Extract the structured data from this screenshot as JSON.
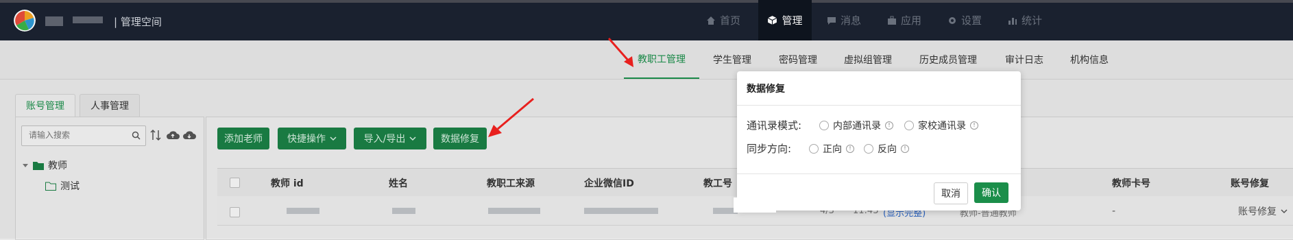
{
  "header": {
    "space_label": "| 管理空间",
    "nav": [
      {
        "label": "首页",
        "icon": "home-icon"
      },
      {
        "label": "管理",
        "icon": "cube-icon"
      },
      {
        "label": "消息",
        "icon": "message-icon"
      },
      {
        "label": "应用",
        "icon": "briefcase-icon"
      },
      {
        "label": "设置",
        "icon": "gear-icon"
      },
      {
        "label": "统计",
        "icon": "chart-icon"
      }
    ]
  },
  "subnav": [
    "教职工管理",
    "学生管理",
    "密码管理",
    "虚拟组管理",
    "历史成员管理",
    "审计日志",
    "机构信息"
  ],
  "left": {
    "tabs": [
      "账号管理",
      "人事管理"
    ],
    "search_placeholder": "请输入搜索",
    "tree_root": "教师",
    "tree_child": "测试"
  },
  "toolbar": {
    "add": "添加老师",
    "quick": "快捷操作",
    "io": "导入/导出",
    "repair": "数据修复"
  },
  "table": {
    "headers": [
      "教师 id",
      "姓名",
      "教职工来源",
      "企业微信ID",
      "教工号",
      "教师卡号",
      "账号修复"
    ],
    "row": {
      "partial_left": "4/3",
      "partial_mid": "11:43",
      "partial_link": "(显示完整)",
      "partial_role": "教师-普通教师",
      "card": "-",
      "repair": "账号修复"
    }
  },
  "modal": {
    "title": "数据修复",
    "mode_label": "通讯录模式:",
    "mode_options": [
      "内部通讯录",
      "家校通讯录"
    ],
    "dir_label": "同步方向:",
    "dir_options": [
      "正向",
      "反向"
    ],
    "cancel": "取消",
    "confirm": "确认"
  },
  "colors": {
    "accent": "#1b8e4a",
    "header_bg": "#1c2331",
    "arrow": "#e8201e"
  }
}
